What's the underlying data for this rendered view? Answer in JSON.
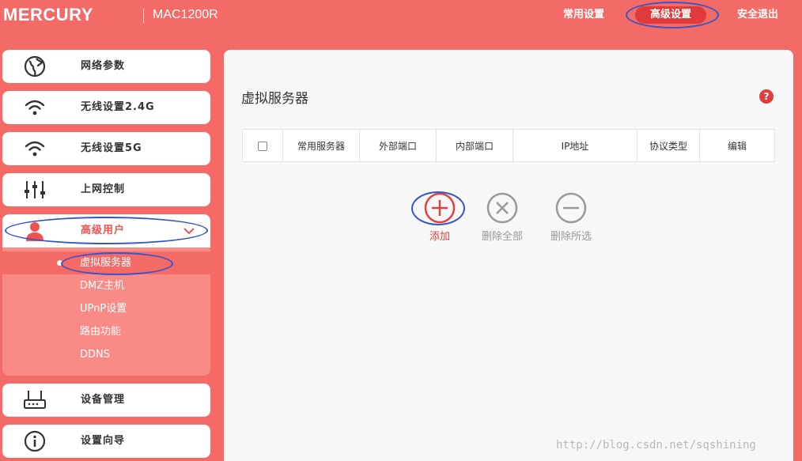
{
  "header": {
    "brand": "MERCURY",
    "model": "MAC1200R",
    "nav": {
      "common": "常用设置",
      "advanced": "高级设置",
      "logout": "安全退出"
    }
  },
  "sidebar": {
    "items": [
      {
        "label": "网络参数",
        "icon": "globe-icon"
      },
      {
        "label": "无线设置2.4G",
        "icon": "wifi-icon"
      },
      {
        "label": "无线设置5G",
        "icon": "wifi-icon"
      },
      {
        "label": "上网控制",
        "icon": "sliders-icon"
      },
      {
        "label": "高级用户",
        "icon": "user-icon",
        "expanded": true
      },
      {
        "label": "设备管理",
        "icon": "router-icon"
      },
      {
        "label": "设置向导",
        "icon": "info-icon"
      }
    ],
    "sub_items": [
      {
        "label": "虚拟服务器",
        "active": true
      },
      {
        "label": "DMZ主机"
      },
      {
        "label": "UPnP设置"
      },
      {
        "label": "路由功能"
      },
      {
        "label": "DDNS"
      }
    ]
  },
  "main": {
    "title": "虚拟服务器",
    "help": "?",
    "table": {
      "headers": [
        "常用服务器",
        "外部端口",
        "内部端口",
        "IP地址",
        "协议类型",
        "编辑"
      ]
    },
    "actions": {
      "add": "添加",
      "delete_all": "删除全部",
      "delete_selected": "删除所选"
    }
  },
  "watermark": "http://blog.csdn.net/sqshining",
  "colors": {
    "background": "#f46a67",
    "accent_red": "#e23d3d",
    "annotation_ring": "#3555c9",
    "panel": "#f7f7f7"
  }
}
